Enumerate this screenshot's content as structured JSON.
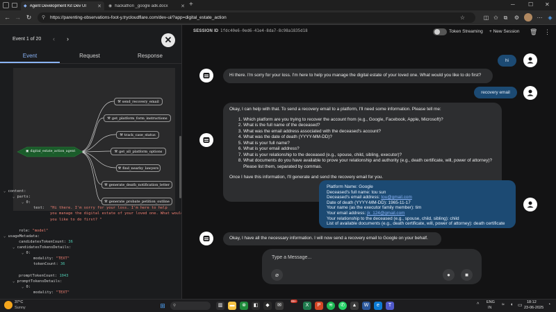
{
  "browser": {
    "tabs": [
      {
        "label": "Agent Development Kit Dev UI",
        "active": true
      },
      {
        "label": "hackathon _google adk.docx",
        "active": false
      }
    ],
    "url": "https://parenting-observations-foot-y.trycloudflare.com/dev-ui/?app=digital_estate_action"
  },
  "left_panel": {
    "event_label": "Event 1 of 20",
    "tabs": [
      "Event",
      "Request",
      "Response"
    ],
    "graph": {
      "root": "digital_estate_action_agent",
      "tools": [
        "send_recovery_email",
        "get_platform_form_instructions",
        "track_case_status",
        "get_all_platform_options",
        "find_nearby_lawyers",
        "generate_death_notification_letter",
        "generate_probate_petition_outline"
      ]
    },
    "json": {
      "content_key": "content:",
      "parts_key": "parts:",
      "idx0": "0:",
      "text_key": "text:",
      "text_l1": "\"Hi there. I'm sorry for your loss. I'm here to help",
      "text_l2": "you manage the digital estate of your loved one. What would",
      "text_l3": "you like to do first? \"",
      "role_key": "role:",
      "role_val": "\"model\"",
      "usage_key": "usageMetadata:",
      "cand_count_key": "candidatesTokenCount:",
      "cand_count_val": "36",
      "cand_details_key": "candidatesTokensDetails:",
      "modality_key": "modality:",
      "modality_val": "\"TEXT\"",
      "token_count_key": "tokenCount:",
      "token_count_val": "36",
      "prompt_count_key": "promptTokenCount:",
      "prompt_count_val": "1043",
      "prompt_details_key": "promptTokensDetails:",
      "modality_val_cut": "\"TEXT\""
    }
  },
  "right_panel": {
    "session_label": "SESSION ID",
    "session_id": "1fdc40e6-0ed6-41e4-8da7-8c98a1835d18",
    "token_streaming": "Token Streaming",
    "new_session": "+ New Session",
    "messages": {
      "u1": "hi",
      "b1": "Hi there. I'm sorry for your loss. I'm here to help you manage the digital estate of your loved one. What would you like to do first?",
      "u2": "recovery email",
      "b2_intro": "Okay, I can help with that. To send a recovery email to a platform, I'll need some information. Please tell me:",
      "b2_items": [
        "Which platform are you trying to recover the account from (e.g., Google, Facebook, Apple, Microsoft)?",
        "What is the full name of the deceased?",
        "What was the email address associated with the deceased's account?",
        "What was the date of death (YYYY-MM-DD)?",
        "What is your full name?",
        "What is your email address?",
        "What is your relationship to the deceased (e.g., spouse, child, sibling, executor)?",
        "What documents do you have available to prove your relationship and authority (e.g., death certificate, will, power of attorney)? Please list them, separated by commas."
      ],
      "b2_outro": "Once I have this information, I'll generate and send the recovery email for you.",
      "u3": {
        "platform": "Platform Name: Google",
        "deceased": "Deceased's full name: tou sun",
        "email_prefix": "Deceased's email address: ",
        "email": "tou@gmail.com",
        "dod": "Date of death (YYYY-MM-DD): 1965-11-17",
        "your_name": "Your name (as the executor family member): tim",
        "your_email_prefix": "Your email address: ",
        "your_email": "jk_124@gmail.com",
        "relationship": "Your relationship to the deceased (e.g., spouse, child, sibling): child",
        "docs": "List of available documents (e.g., death certificate, will, power of attorney): death certificate"
      },
      "b3": "Okay, I have all the necessary information. I will now send a recovery email to Google on your behalf."
    },
    "composer_placeholder": "Type a Message..."
  },
  "taskbar": {
    "temp": "37°C",
    "weather": "Sunny",
    "lang1": "ENG",
    "lang2": "IN",
    "time": "18:12",
    "date": "23-06-2025",
    "badge": "99+"
  },
  "colors": {
    "accent": "#8ab4f8",
    "user_bubble": "#1c4a73",
    "graph_root": "#1a5c2a",
    "json_string": "#f07f72",
    "json_number": "#4ec9b0"
  }
}
